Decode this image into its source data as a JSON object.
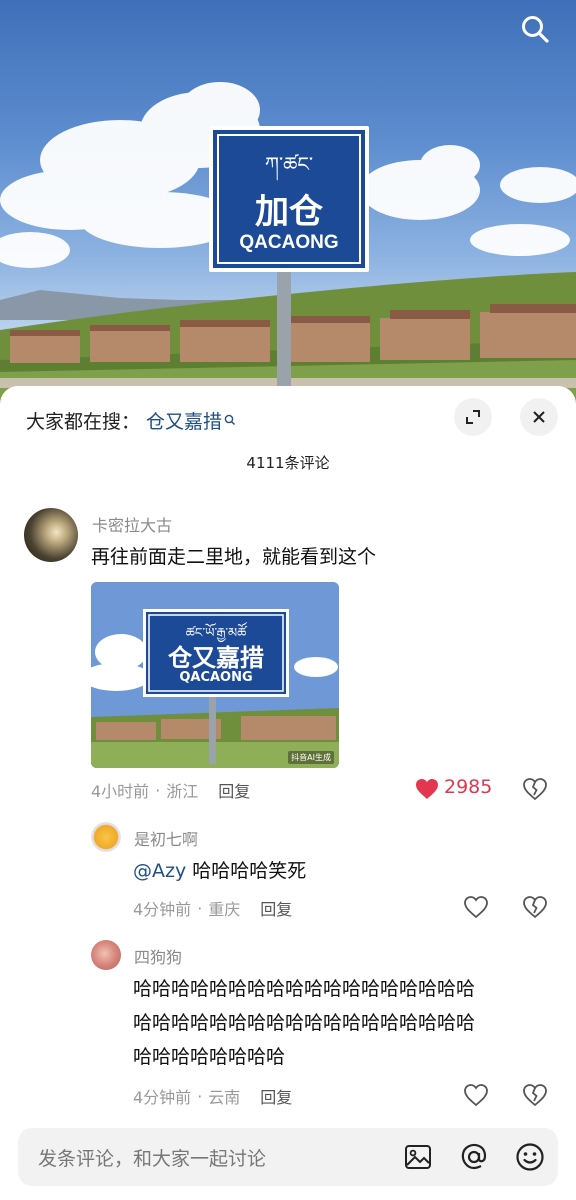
{
  "hero": {
    "sign_tibetan": "ཀ་ཚང་",
    "sign_chinese": "加仓",
    "sign_latin": "QACAONG"
  },
  "trend": {
    "label": "大家都在搜：",
    "query": "仓又嘉措"
  },
  "comment_count": "4111条评论",
  "comments": [
    {
      "name": "卡密拉大古",
      "text": "再往前面走二里地，就能看到这个",
      "time": "4小时前",
      "location": "浙江",
      "reply_label": "回复",
      "likes": "2985",
      "liked": true,
      "image": {
        "sign_tibetan": "ཚང་ཡོ་རྒྱ་མཚོ",
        "sign_chinese": "仓又嘉措",
        "sign_latin": "QACAONG",
        "ai_tag": "抖音AI生成"
      }
    }
  ],
  "replies": [
    {
      "name": "是初七啊",
      "mention": "@Azy",
      "text": " 哈哈哈哈笑死",
      "time": "4分钟前",
      "location": "重庆",
      "reply_label": "回复"
    },
    {
      "name": "四狗狗",
      "lines": [
        "哈哈哈哈哈哈哈哈哈哈哈哈哈哈哈哈哈哈",
        "哈哈哈哈哈哈哈哈哈哈哈哈哈哈哈哈哈哈",
        "哈哈哈哈哈哈哈哈"
      ],
      "time": "4分钟前",
      "location": "云南",
      "reply_label": "回复"
    }
  ],
  "input": {
    "placeholder": "发条评论，和大家一起讨论"
  },
  "colors": {
    "like_red": "#e2374e",
    "link_blue": "#1f4f87",
    "sign_blue": "#1d4a97"
  }
}
